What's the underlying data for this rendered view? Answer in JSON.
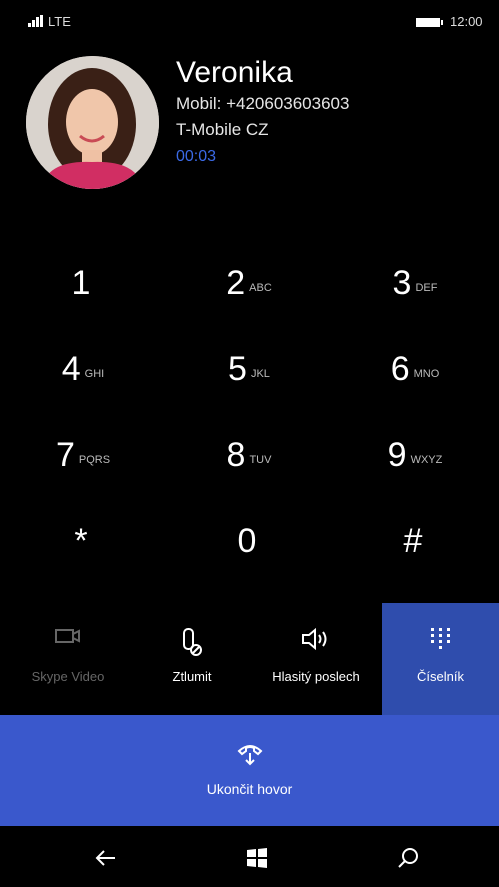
{
  "status": {
    "network": "LTE",
    "time": "12:00"
  },
  "contact": {
    "name": "Veronika",
    "number": "Mobil: +420603603603",
    "carrier": "T-Mobile CZ",
    "timer": "00:03"
  },
  "keypad": [
    {
      "digit": "1",
      "letters": ""
    },
    {
      "digit": "2",
      "letters": "ABC"
    },
    {
      "digit": "3",
      "letters": "DEF"
    },
    {
      "digit": "4",
      "letters": "GHI"
    },
    {
      "digit": "5",
      "letters": "JKL"
    },
    {
      "digit": "6",
      "letters": "MNO"
    },
    {
      "digit": "7",
      "letters": "PQRS"
    },
    {
      "digit": "8",
      "letters": "TUV"
    },
    {
      "digit": "9",
      "letters": "WXYZ"
    },
    {
      "digit": "*",
      "letters": ""
    },
    {
      "digit": "0",
      "letters": ""
    },
    {
      "digit": "#",
      "letters": ""
    }
  ],
  "actions": {
    "skype_video": "Skype Video",
    "mute": "Ztlumit",
    "speaker": "Hlasitý poslech",
    "keypad": "Číselník"
  },
  "end_call": "Ukončit hovor",
  "colors": {
    "accent": "#3a58cc",
    "active": "#2f4dad",
    "timer": "#3b6ae6"
  },
  "icons": [
    "signal-icon",
    "battery-icon",
    "camera-icon",
    "mute-icon",
    "speaker-icon",
    "keypad-icon",
    "end-call-icon",
    "back-icon",
    "windows-icon",
    "search-icon"
  ]
}
